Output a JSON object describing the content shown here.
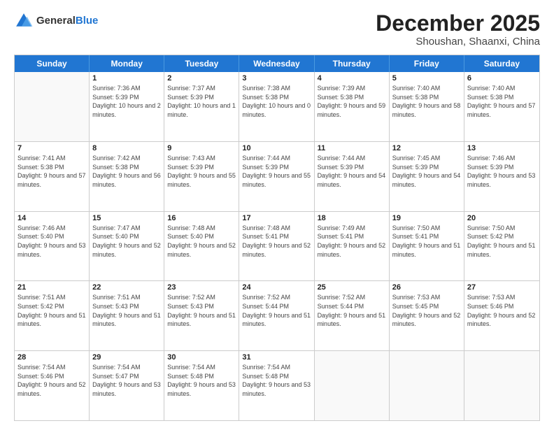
{
  "header": {
    "logo_general": "General",
    "logo_blue": "Blue",
    "month": "December 2025",
    "location": "Shoushan, Shaanxi, China"
  },
  "weekdays": [
    "Sunday",
    "Monday",
    "Tuesday",
    "Wednesday",
    "Thursday",
    "Friday",
    "Saturday"
  ],
  "rows": [
    [
      {
        "day": "",
        "empty": true
      },
      {
        "day": "1",
        "sunrise": "Sunrise: 7:36 AM",
        "sunset": "Sunset: 5:39 PM",
        "daylight": "Daylight: 10 hours and 2 minutes."
      },
      {
        "day": "2",
        "sunrise": "Sunrise: 7:37 AM",
        "sunset": "Sunset: 5:39 PM",
        "daylight": "Daylight: 10 hours and 1 minute."
      },
      {
        "day": "3",
        "sunrise": "Sunrise: 7:38 AM",
        "sunset": "Sunset: 5:38 PM",
        "daylight": "Daylight: 10 hours and 0 minutes."
      },
      {
        "day": "4",
        "sunrise": "Sunrise: 7:39 AM",
        "sunset": "Sunset: 5:38 PM",
        "daylight": "Daylight: 9 hours and 59 minutes."
      },
      {
        "day": "5",
        "sunrise": "Sunrise: 7:40 AM",
        "sunset": "Sunset: 5:38 PM",
        "daylight": "Daylight: 9 hours and 58 minutes."
      },
      {
        "day": "6",
        "sunrise": "Sunrise: 7:40 AM",
        "sunset": "Sunset: 5:38 PM",
        "daylight": "Daylight: 9 hours and 57 minutes."
      }
    ],
    [
      {
        "day": "7",
        "sunrise": "Sunrise: 7:41 AM",
        "sunset": "Sunset: 5:38 PM",
        "daylight": "Daylight: 9 hours and 57 minutes."
      },
      {
        "day": "8",
        "sunrise": "Sunrise: 7:42 AM",
        "sunset": "Sunset: 5:38 PM",
        "daylight": "Daylight: 9 hours and 56 minutes."
      },
      {
        "day": "9",
        "sunrise": "Sunrise: 7:43 AM",
        "sunset": "Sunset: 5:39 PM",
        "daylight": "Daylight: 9 hours and 55 minutes."
      },
      {
        "day": "10",
        "sunrise": "Sunrise: 7:44 AM",
        "sunset": "Sunset: 5:39 PM",
        "daylight": "Daylight: 9 hours and 55 minutes."
      },
      {
        "day": "11",
        "sunrise": "Sunrise: 7:44 AM",
        "sunset": "Sunset: 5:39 PM",
        "daylight": "Daylight: 9 hours and 54 minutes."
      },
      {
        "day": "12",
        "sunrise": "Sunrise: 7:45 AM",
        "sunset": "Sunset: 5:39 PM",
        "daylight": "Daylight: 9 hours and 54 minutes."
      },
      {
        "day": "13",
        "sunrise": "Sunrise: 7:46 AM",
        "sunset": "Sunset: 5:39 PM",
        "daylight": "Daylight: 9 hours and 53 minutes."
      }
    ],
    [
      {
        "day": "14",
        "sunrise": "Sunrise: 7:46 AM",
        "sunset": "Sunset: 5:40 PM",
        "daylight": "Daylight: 9 hours and 53 minutes."
      },
      {
        "day": "15",
        "sunrise": "Sunrise: 7:47 AM",
        "sunset": "Sunset: 5:40 PM",
        "daylight": "Daylight: 9 hours and 52 minutes."
      },
      {
        "day": "16",
        "sunrise": "Sunrise: 7:48 AM",
        "sunset": "Sunset: 5:40 PM",
        "daylight": "Daylight: 9 hours and 52 minutes."
      },
      {
        "day": "17",
        "sunrise": "Sunrise: 7:48 AM",
        "sunset": "Sunset: 5:41 PM",
        "daylight": "Daylight: 9 hours and 52 minutes."
      },
      {
        "day": "18",
        "sunrise": "Sunrise: 7:49 AM",
        "sunset": "Sunset: 5:41 PM",
        "daylight": "Daylight: 9 hours and 52 minutes."
      },
      {
        "day": "19",
        "sunrise": "Sunrise: 7:50 AM",
        "sunset": "Sunset: 5:41 PM",
        "daylight": "Daylight: 9 hours and 51 minutes."
      },
      {
        "day": "20",
        "sunrise": "Sunrise: 7:50 AM",
        "sunset": "Sunset: 5:42 PM",
        "daylight": "Daylight: 9 hours and 51 minutes."
      }
    ],
    [
      {
        "day": "21",
        "sunrise": "Sunrise: 7:51 AM",
        "sunset": "Sunset: 5:42 PM",
        "daylight": "Daylight: 9 hours and 51 minutes."
      },
      {
        "day": "22",
        "sunrise": "Sunrise: 7:51 AM",
        "sunset": "Sunset: 5:43 PM",
        "daylight": "Daylight: 9 hours and 51 minutes."
      },
      {
        "day": "23",
        "sunrise": "Sunrise: 7:52 AM",
        "sunset": "Sunset: 5:43 PM",
        "daylight": "Daylight: 9 hours and 51 minutes."
      },
      {
        "day": "24",
        "sunrise": "Sunrise: 7:52 AM",
        "sunset": "Sunset: 5:44 PM",
        "daylight": "Daylight: 9 hours and 51 minutes."
      },
      {
        "day": "25",
        "sunrise": "Sunrise: 7:52 AM",
        "sunset": "Sunset: 5:44 PM",
        "daylight": "Daylight: 9 hours and 51 minutes."
      },
      {
        "day": "26",
        "sunrise": "Sunrise: 7:53 AM",
        "sunset": "Sunset: 5:45 PM",
        "daylight": "Daylight: 9 hours and 52 minutes."
      },
      {
        "day": "27",
        "sunrise": "Sunrise: 7:53 AM",
        "sunset": "Sunset: 5:46 PM",
        "daylight": "Daylight: 9 hours and 52 minutes."
      }
    ],
    [
      {
        "day": "28",
        "sunrise": "Sunrise: 7:54 AM",
        "sunset": "Sunset: 5:46 PM",
        "daylight": "Daylight: 9 hours and 52 minutes."
      },
      {
        "day": "29",
        "sunrise": "Sunrise: 7:54 AM",
        "sunset": "Sunset: 5:47 PM",
        "daylight": "Daylight: 9 hours and 53 minutes."
      },
      {
        "day": "30",
        "sunrise": "Sunrise: 7:54 AM",
        "sunset": "Sunset: 5:48 PM",
        "daylight": "Daylight: 9 hours and 53 minutes."
      },
      {
        "day": "31",
        "sunrise": "Sunrise: 7:54 AM",
        "sunset": "Sunset: 5:48 PM",
        "daylight": "Daylight: 9 hours and 53 minutes."
      },
      {
        "day": "",
        "empty": true
      },
      {
        "day": "",
        "empty": true
      },
      {
        "day": "",
        "empty": true
      }
    ]
  ]
}
